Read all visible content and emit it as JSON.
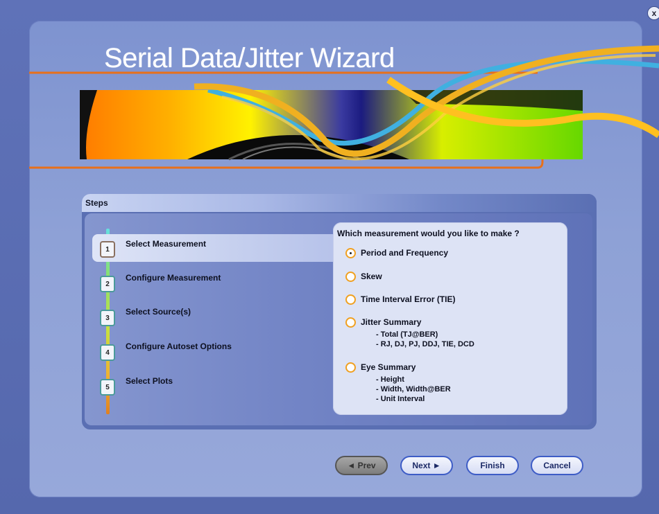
{
  "window": {
    "title": "Serial Data/Jitter Wizard",
    "close_label": "x"
  },
  "steps": {
    "header": "Steps",
    "items": [
      {
        "number": "1",
        "label": "Select Measurement"
      },
      {
        "number": "2",
        "label": "Configure Measurement"
      },
      {
        "number": "3",
        "label": "Select Source(s)"
      },
      {
        "number": "4",
        "label": "Configure Autoset Options"
      },
      {
        "number": "5",
        "label": "Select Plots"
      }
    ],
    "active_index": 0
  },
  "measurement": {
    "question": "Which measurement would you like to make ?",
    "options": [
      {
        "label": "Period and Frequency",
        "selected": true
      },
      {
        "label": "Skew",
        "selected": false
      },
      {
        "label": "Time Interval Error (TIE)",
        "selected": false
      },
      {
        "label": "Jitter Summary",
        "selected": false,
        "details": [
          "- Total (TJ@BER)",
          "- RJ, DJ, PJ, DDJ, TIE, DCD"
        ]
      },
      {
        "label": "Eye Summary",
        "selected": false,
        "details": [
          "- Height",
          "- Width, Width@BER",
          "- Unit Interval"
        ]
      }
    ]
  },
  "buttons": {
    "prev": "◄ Prev",
    "next": "Next ►",
    "finish": "Finish",
    "cancel": "Cancel"
  },
  "colors": {
    "background": "#5f72b8",
    "panel": "#8a9dd4",
    "accent_orange": "#f0a020",
    "button_border": "#3d5cc6"
  }
}
